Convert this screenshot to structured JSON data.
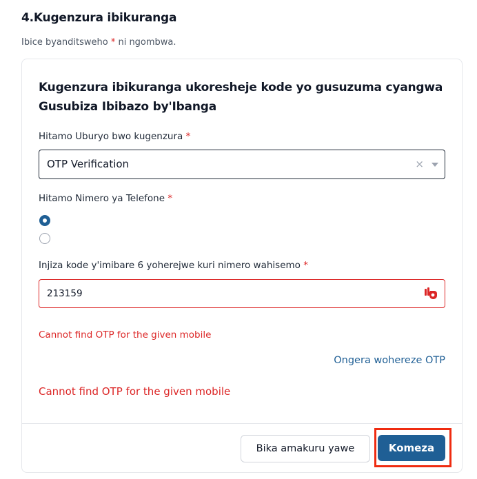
{
  "section": {
    "title": "4.Kugenzura ibikuranga",
    "required_note_before": "Ibice byanditsweho ",
    "required_star": "*",
    "required_note_after": " ni ngombwa."
  },
  "card": {
    "title": "Kugenzura ibikuranga ukoresheje kode yo gusuzuma cyangwa Gusubiza Ibibazo by'Ibanga",
    "method_field": {
      "label": "Hitamo Uburyo bwo kugenzura",
      "required_star": "*",
      "selected_value": "OTP Verification",
      "clear_symbol": "×"
    },
    "phone_field": {
      "label": "Hitamo Nimero ya Telefone",
      "required_star": "*",
      "options": [
        {
          "label": "",
          "checked": true
        },
        {
          "label": "",
          "checked": false
        }
      ]
    },
    "otp_field": {
      "label": "Injiza kode y'imibare 6 yoherejwe kuri nimero wahisemo",
      "required_star": "*",
      "value": "213159",
      "icon": "password-manager-icon"
    },
    "error_inline": "Cannot find OTP for the given mobile",
    "resend_link": "Ongera wohereze OTP",
    "error_main": "Cannot find OTP for the given mobile"
  },
  "footer": {
    "save_label": "Bika amakuru yawe",
    "continue_label": "Komeza"
  },
  "colors": {
    "primary": "#1f5f95",
    "error": "#dc2626",
    "highlight": "#ef2b10"
  }
}
